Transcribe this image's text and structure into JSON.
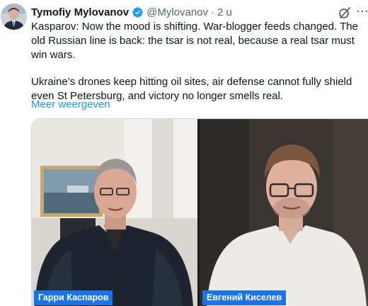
{
  "tweet": {
    "display_name": "Tymofiy Mylovanov",
    "handle": "@Mylovanov",
    "separator": "·",
    "time": "2 u",
    "paragraphs": [
      "Kasparov: Now the mood is shifting. War-blogger feeds changed. The old Russian line is back: the tsar is not real, because a real tsar must win wars.",
      "Ukraine’s drones keep hitting oil sites, air defense cannot fully shield even St Petersburg, and victory no longer smells real."
    ],
    "show_more": "Meer weergeven"
  },
  "video": {
    "left_name": "Гарри Каспаров",
    "right_name": "Евгений Киселев",
    "tag_color": "#1a73e8"
  },
  "icons": {
    "verified": "verified-badge-icon",
    "grok": "grok-icon",
    "more": "more-options-icon"
  },
  "colors": {
    "link": "#1d9bf0",
    "verified": "#1d9bf0",
    "secondary_text": "#536471"
  }
}
